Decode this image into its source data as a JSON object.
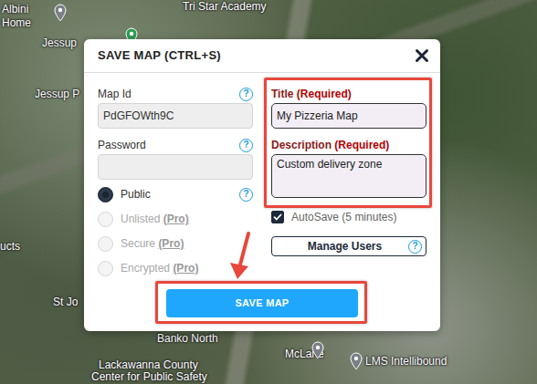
{
  "map": {
    "labels": [
      {
        "text": "Tri Star Academy"
      },
      {
        "text": "Albini"
      },
      {
        "text": "Home"
      },
      {
        "text": "Jessup"
      },
      {
        "text": "Jessup P"
      },
      {
        "text": "ucts"
      },
      {
        "text": "St Jo"
      },
      {
        "text": "Banko North"
      },
      {
        "text": "Lackawanna County"
      },
      {
        "text": "Center for Public Safety"
      },
      {
        "text": "McLane"
      },
      {
        "text": "LMS Intellibound"
      }
    ]
  },
  "dialog": {
    "title": "SAVE MAP (CTRL+S)",
    "map_id": {
      "label": "Map Id",
      "value": "PdGFOWth9C",
      "help": "?"
    },
    "password": {
      "label": "Password",
      "value": "",
      "help": "?"
    },
    "visibility_help": "?",
    "visibility": [
      {
        "label": "Public",
        "selected": true,
        "disabled": false
      },
      {
        "label": "Unlisted",
        "pro": "(Pro)",
        "selected": false,
        "disabled": true
      },
      {
        "label": "Secure",
        "pro": "(Pro)",
        "selected": false,
        "disabled": true
      },
      {
        "label": "Encrypted",
        "pro": "(Pro)",
        "selected": false,
        "disabled": true
      }
    ],
    "title_field": {
      "label": "Title",
      "required": "(Required)",
      "value": "My Pizzeria Map"
    },
    "description_field": {
      "label": "Description",
      "required": "(Required)",
      "value": "Custom delivery zone"
    },
    "autosave": {
      "label": "AutoSave (5 minutes)",
      "checked": true
    },
    "manage_users": {
      "label": "Manage Users",
      "help": "?"
    },
    "save_button": "SAVE MAP"
  }
}
